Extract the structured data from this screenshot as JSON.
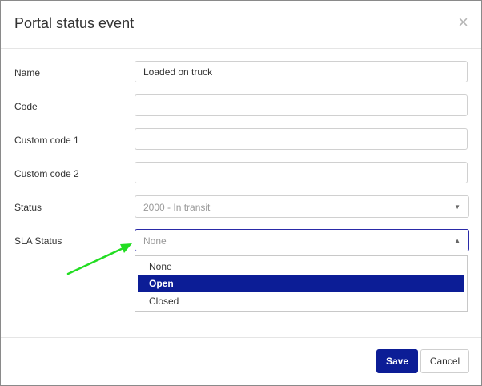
{
  "dialog": {
    "title": "Portal status event",
    "close_glyph": "×"
  },
  "form": {
    "name": {
      "label": "Name",
      "value": "Loaded on truck"
    },
    "code": {
      "label": "Code",
      "value": ""
    },
    "custom_code_1": {
      "label": "Custom code 1",
      "value": ""
    },
    "custom_code_2": {
      "label": "Custom code 2",
      "value": ""
    },
    "status": {
      "label": "Status",
      "value": "2000 - In transit"
    },
    "sla_status": {
      "label": "SLA Status",
      "value": "None",
      "options": [
        "None",
        "Open",
        "Closed"
      ],
      "highlighted": "Open"
    }
  },
  "footer": {
    "save_label": "Save",
    "cancel_label": "Cancel"
  },
  "colors": {
    "accent": "#0c1d96",
    "annotation_arrow": "#22dd22"
  }
}
